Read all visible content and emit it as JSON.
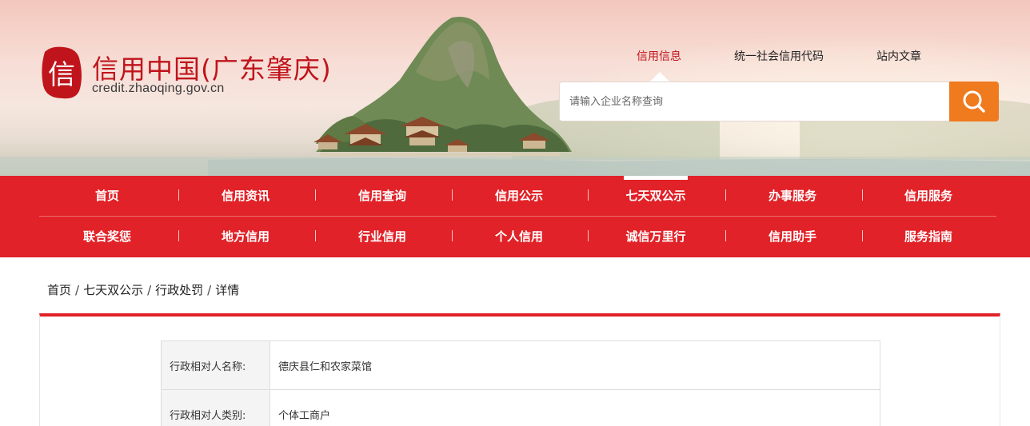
{
  "header": {
    "logo_glyph": "信",
    "site_title": "信用中国(广东肇庆)",
    "site_domain": "credit.zhaoqing.gov.cn"
  },
  "search": {
    "tabs": [
      {
        "label": "信用信息",
        "active": true
      },
      {
        "label": "统一社会信用代码",
        "active": false
      },
      {
        "label": "站内文章",
        "active": false
      }
    ],
    "placeholder": "请输入企业名称查询",
    "button_icon": "search-icon"
  },
  "nav": {
    "row1": [
      {
        "label": "首页",
        "active": false
      },
      {
        "label": "信用资讯",
        "active": false
      },
      {
        "label": "信用查询",
        "active": false
      },
      {
        "label": "信用公示",
        "active": false
      },
      {
        "label": "七天双公示",
        "active": true
      },
      {
        "label": "办事服务",
        "active": false
      },
      {
        "label": "信用服务",
        "active": false
      }
    ],
    "row2": [
      {
        "label": "联合奖惩",
        "active": false
      },
      {
        "label": "地方信用",
        "active": false
      },
      {
        "label": "行业信用",
        "active": false
      },
      {
        "label": "个人信用",
        "active": false
      },
      {
        "label": "诚信万里行",
        "active": false
      },
      {
        "label": "信用助手",
        "active": false
      },
      {
        "label": "服务指南",
        "active": false
      }
    ],
    "separator": "|"
  },
  "breadcrumb": {
    "items": [
      "首页",
      "七天双公示",
      "行政处罚",
      "详情"
    ],
    "separator": "/"
  },
  "detail": {
    "rows": [
      {
        "label": "行政相对人名称:",
        "value": "德庆县仁和农家菜馆"
      },
      {
        "label": "行政相对人类别:",
        "value": "个体工商户"
      }
    ]
  },
  "colors": {
    "brand_red": "#e12228",
    "title_red": "#c0141c",
    "search_orange": "#f07a1e"
  }
}
